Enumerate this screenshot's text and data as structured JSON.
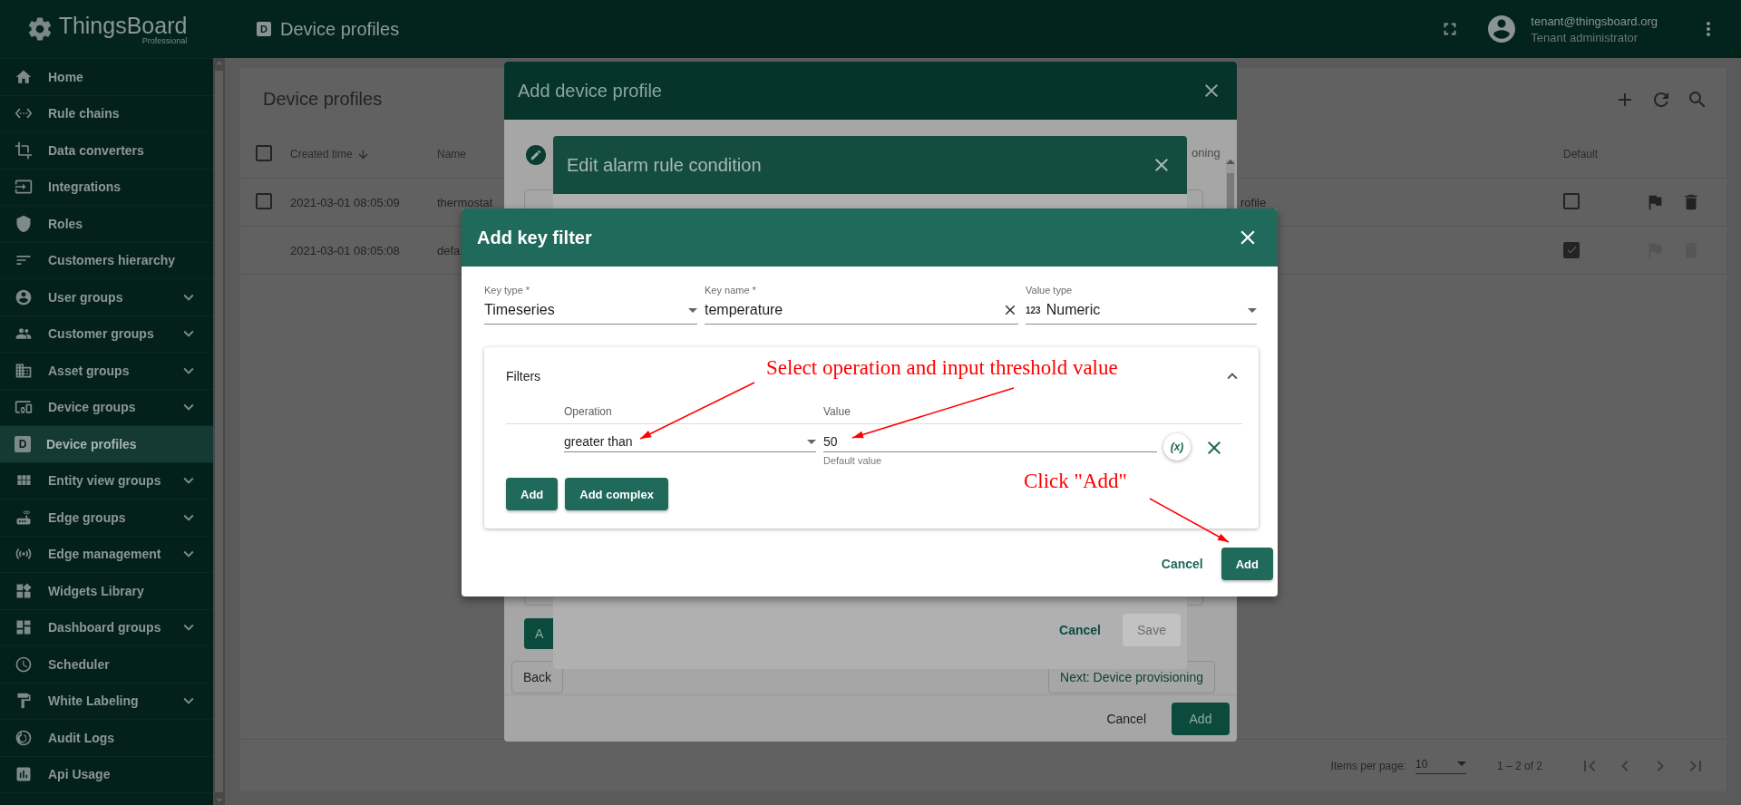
{
  "app": {
    "logo": "ThingsBoard",
    "logo_sub": "Professional"
  },
  "header": {
    "page_icon_letter": "D",
    "page_title": "Device profiles",
    "user_email": "tenant@thingsboard.org",
    "user_role": "Tenant administrator"
  },
  "sidebar": {
    "items": [
      {
        "label": "Home",
        "expandable": false,
        "selected": false
      },
      {
        "label": "Rule chains",
        "expandable": false,
        "selected": false
      },
      {
        "label": "Data converters",
        "expandable": false,
        "selected": false
      },
      {
        "label": "Integrations",
        "expandable": false,
        "selected": false
      },
      {
        "label": "Roles",
        "expandable": false,
        "selected": false
      },
      {
        "label": "Customers hierarchy",
        "expandable": false,
        "selected": false
      },
      {
        "label": "User groups",
        "expandable": true,
        "selected": false
      },
      {
        "label": "Customer groups",
        "expandable": true,
        "selected": false
      },
      {
        "label": "Asset groups",
        "expandable": true,
        "selected": false
      },
      {
        "label": "Device groups",
        "expandable": true,
        "selected": false
      },
      {
        "label": "Device profiles",
        "expandable": false,
        "selected": true,
        "icon_letter": "D"
      },
      {
        "label": "Entity view groups",
        "expandable": true,
        "selected": false
      },
      {
        "label": "Edge groups",
        "expandable": true,
        "selected": false
      },
      {
        "label": "Edge management",
        "expandable": true,
        "selected": false
      },
      {
        "label": "Widgets Library",
        "expandable": false,
        "selected": false
      },
      {
        "label": "Dashboard groups",
        "expandable": true,
        "selected": false
      },
      {
        "label": "Scheduler",
        "expandable": false,
        "selected": false
      },
      {
        "label": "White Labeling",
        "expandable": true,
        "selected": false
      },
      {
        "label": "Audit Logs",
        "expandable": false,
        "selected": false
      },
      {
        "label": "Api Usage",
        "expandable": false,
        "selected": false
      }
    ]
  },
  "page": {
    "title": "Device profiles",
    "table": {
      "all_checked": false,
      "columns": [
        {
          "label": "Created time",
          "sorted": true
        },
        {
          "label": "Name",
          "sorted": false
        },
        {
          "label": "Default",
          "sorted": false
        }
      ],
      "rows": [
        {
          "selectable": true,
          "checked": false,
          "created_time": "2021-03-01 08:05:09",
          "name": "thermostat",
          "column_3": "rofile",
          "default": false,
          "actions_enabled": true
        },
        {
          "selectable": false,
          "created_time": "2021-03-01 08:05:08",
          "name": "defa",
          "default": true,
          "actions_enabled": false
        }
      ]
    },
    "pagination": {
      "label": "Items per page:",
      "page_size": "10",
      "range": "1 – 2 of 2"
    }
  },
  "add_device_profile_dialog": {
    "title": "Add device profile",
    "step_label": "oning",
    "inner_button": "A",
    "back": "Back",
    "next": "Next: Device provisioning",
    "cancel": "Cancel",
    "add": "Add"
  },
  "edit_alarm_rule_dialog": {
    "title": "Edit alarm rule condition",
    "cancel": "Cancel",
    "save": "Save",
    "save_disabled": true
  },
  "key_filter_dialog": {
    "title": "Add key filter",
    "fields": [
      {
        "label": "Key type *",
        "value": "Timeseries",
        "kind": "select"
      },
      {
        "label": "Key name *",
        "value": "temperature",
        "kind": "clearable"
      },
      {
        "label": "Value type",
        "value": "Numeric",
        "kind": "select",
        "prefix": "123"
      }
    ],
    "filters": {
      "title": "Filters",
      "expanded": true,
      "operation_label": "Operation",
      "operation": "greater than",
      "value_label": "Value",
      "value": "50",
      "value_hint": "Default value",
      "dynamic_button": "(x)",
      "buttons": [
        "Add",
        "Add complex"
      ]
    },
    "buttons": [
      {
        "label": "Cancel",
        "kind": "text"
      },
      {
        "label": "Add",
        "kind": "primary"
      }
    ]
  },
  "annotations": [
    {
      "text": "Select operation and input threshold value"
    },
    {
      "text": "Click \"Add\""
    }
  ]
}
